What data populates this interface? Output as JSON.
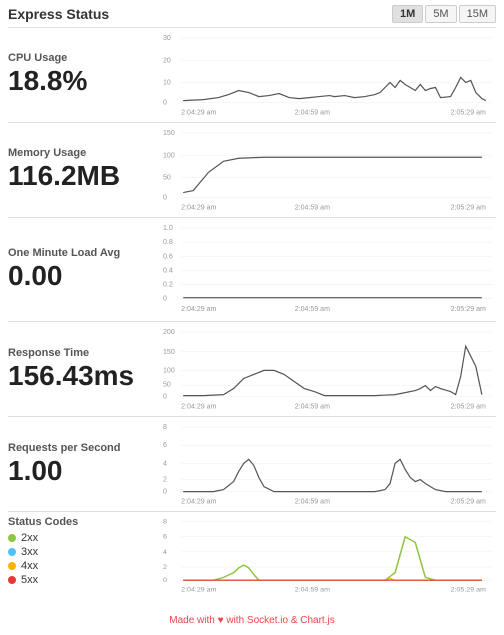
{
  "header": {
    "title": "Express Status",
    "buttons": [
      "1M",
      "5M",
      "15M"
    ],
    "active_button": "1M"
  },
  "metrics": [
    {
      "id": "cpu",
      "label": "CPU Usage",
      "value": "18.8%",
      "y_max": "30",
      "y_ticks": [
        "30",
        "20",
        "10",
        "0"
      ],
      "x_ticks": [
        "2:04:29 am",
        "2:04:59 am",
        "2:05:29 am"
      ],
      "chart_type": "cpu"
    },
    {
      "id": "memory",
      "label": "Memory Usage",
      "value": "116.2MB",
      "y_max": "150",
      "y_ticks": [
        "150",
        "100",
        "50",
        "0"
      ],
      "x_ticks": [
        "2:04:29 am",
        "2:04:59 am",
        "2:05:29 am"
      ],
      "chart_type": "memory"
    },
    {
      "id": "load",
      "label": "One Minute Load Avg",
      "value": "0.00",
      "y_max": "1.0",
      "y_ticks": [
        "1.0",
        "0.8",
        "0.6",
        "0.4",
        "0.2",
        "0"
      ],
      "x_ticks": [
        "2:04:29 am",
        "2:04:59 am",
        "2:05:29 am"
      ],
      "chart_type": "load"
    },
    {
      "id": "response",
      "label": "Response Time",
      "value": "156.43ms",
      "y_max": "200",
      "y_ticks": [
        "200",
        "150",
        "100",
        "50",
        "0"
      ],
      "x_ticks": [
        "2:04:29 am",
        "2:04:59 am",
        "2:05:29 am"
      ],
      "chart_type": "response"
    },
    {
      "id": "rps",
      "label": "Requests per Second",
      "value": "1.00",
      "y_max": "8",
      "y_ticks": [
        "8",
        "6",
        "4",
        "2",
        "0"
      ],
      "x_ticks": [
        "2:04:29 am",
        "2:04:59 am",
        "2:05:29 am"
      ],
      "chart_type": "rps"
    }
  ],
  "status_codes": {
    "label": "Status Codes",
    "legend": [
      {
        "code": "2xx",
        "color": "#8dc63f"
      },
      {
        "code": "3xx",
        "color": "#4fc3f7"
      },
      {
        "code": "4xx",
        "color": "#ffb300"
      },
      {
        "code": "5xx",
        "color": "#e53935"
      }
    ],
    "y_ticks": [
      "8",
      "6",
      "4",
      "2",
      "0"
    ],
    "x_ticks": [
      "2:04:29 am",
      "2:04:59 am",
      "2:05:29 am"
    ]
  },
  "footer": {
    "text": "Made with",
    "heart": "♥",
    "rest": "with Socket.io & Chart.js"
  }
}
